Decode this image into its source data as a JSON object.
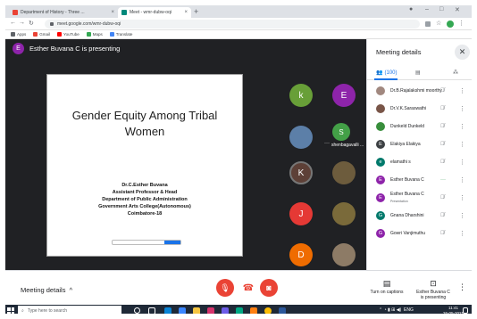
{
  "browser": {
    "tabs": [
      {
        "label": "Department of History - Three ...",
        "color": "#ea4335"
      },
      {
        "label": "Meet - wmr-dubw-oqi",
        "color": "#00897b"
      }
    ],
    "new_tab": "+",
    "url": "meet.google.com/wmr-dubw-oqi",
    "bookmarks": [
      {
        "label": "Apps",
        "color": "#5f6368"
      },
      {
        "label": "Gmail",
        "color": "#ea4335"
      },
      {
        "label": "YouTube",
        "color": "#ff0000"
      },
      {
        "label": "Maps",
        "color": "#34a853"
      },
      {
        "label": "Translate",
        "color": "#4285f4"
      }
    ]
  },
  "meet": {
    "presenter_initial": "E",
    "presenter_text": "Esther Buvana C is presenting",
    "slide": {
      "title_line1": "Gender Equity Among Tribal",
      "title_line2": "Women",
      "author": "Dr.C.Esther Buvana",
      "role1": "Assistant Professor & Head",
      "role2": "Department of Public Administration",
      "college": "Government Arts College(Autonomous)",
      "city": "Coimbatore-18"
    },
    "tiles": [
      {
        "initial": "k",
        "color": "#689f38"
      },
      {
        "initial": "E",
        "color": "#8e24aa"
      },
      {
        "initial": "",
        "color": "#5c7fa8"
      },
      {
        "initial": "S",
        "color": "#43a047"
      },
      {
        "initial": "K",
        "color": "#5d4037"
      },
      {
        "initial": "",
        "color": "#6d5c3d"
      },
      {
        "initial": "J",
        "color": "#e53935"
      },
      {
        "initial": "",
        "color": "#7a6a3a"
      },
      {
        "initial": "D",
        "color": "#ef6c00"
      },
      {
        "initial": "",
        "color": "#8d7b66"
      }
    ],
    "tile_label": "shenbagavalli ...",
    "panel": {
      "title": "Meeting details",
      "people_count": "(100)",
      "participants": [
        {
          "name": "Dr.B.Rajalakshmi moorthy",
          "initial": "",
          "color": "#a1887f",
          "sub": ""
        },
        {
          "name": "Dr.V.K.Saraswathi",
          "initial": "",
          "color": "#795548",
          "sub": ""
        },
        {
          "name": "Dunkeld Dunkeld",
          "initial": "",
          "color": "#388e3c",
          "sub": ""
        },
        {
          "name": "Elakiya Elakiya",
          "initial": "E",
          "color": "#3c4043",
          "sub": ""
        },
        {
          "name": "elamathi s",
          "initial": "e",
          "color": "#00796b",
          "sub": ""
        },
        {
          "name": "Esther Buvana C",
          "initial": "E",
          "color": "#8e24aa",
          "sub": ""
        },
        {
          "name": "Esther Buvana C",
          "initial": "E",
          "color": "#8e24aa",
          "sub": "Presentation"
        },
        {
          "name": "Gnana Dharshini",
          "initial": "G",
          "color": "#00796b",
          "sub": ""
        },
        {
          "name": "Gowri Vanjimuthu",
          "initial": "G",
          "color": "#8e24aa",
          "sub": ""
        }
      ]
    },
    "controls": {
      "meeting_details": "Meeting details",
      "captions_label": "Turn on captions",
      "presenting_line1": "Esther Buvana C",
      "presenting_line2": "is presenting",
      "mic_color": "#ea4335",
      "end_color": "#ea4335",
      "cam_color": "#ea4335"
    }
  },
  "taskbar": {
    "search_placeholder": "Type here to search",
    "tray_text": "ENG",
    "time": "11:41",
    "date": "26-05-2021"
  }
}
